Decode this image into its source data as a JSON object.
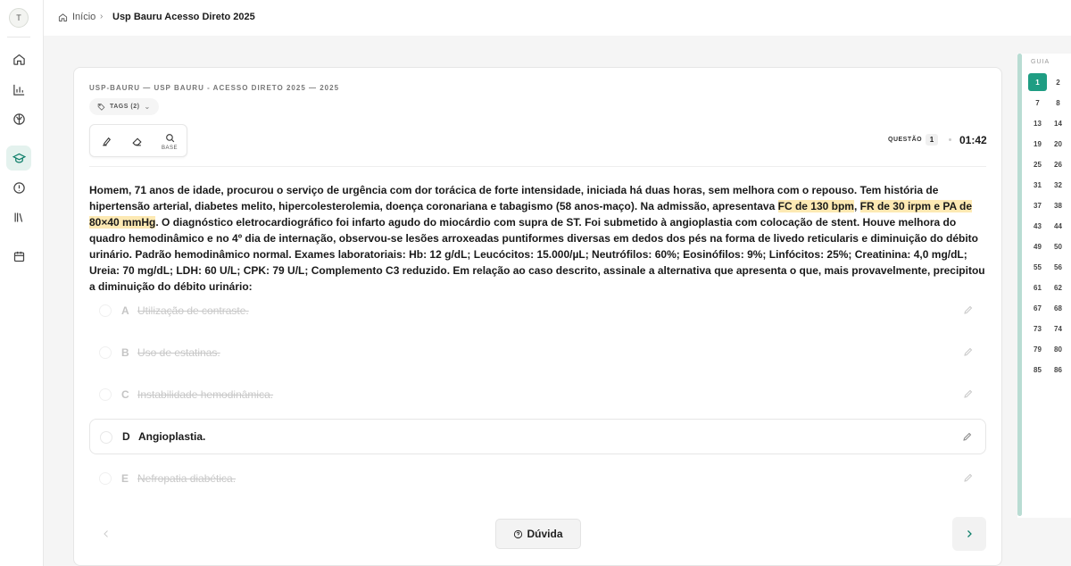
{
  "sidebar": {
    "avatar_initial": "T",
    "items": [
      {
        "icon": "home-icon",
        "active": false
      },
      {
        "icon": "bar-chart-icon",
        "active": false
      },
      {
        "icon": "brain-icon",
        "active": false
      },
      {
        "icon": "graduation-cap-icon",
        "active": true
      },
      {
        "icon": "alert-circle-icon",
        "active": false
      },
      {
        "icon": "library-icon",
        "active": false
      },
      {
        "icon": "calendar-icon",
        "active": false
      }
    ]
  },
  "breadcrumb": {
    "home": "Início",
    "separator": "›",
    "current": "Usp Bauru Acesso Direto 2025"
  },
  "card": {
    "header": "USP-BAURU — USP BAURU - ACESSO DIRETO 2025 — 2025",
    "tags_label": "TAGS (2)",
    "toolbar": {
      "base_label": "BASE"
    },
    "question_label": "QUESTÃO",
    "question_number": "1",
    "timer": "01:42"
  },
  "question": {
    "part1": "Homem, 71 anos de idade, procurou o serviço de urgência com dor torácica de forte intensidade, iniciada há duas horas, sem melhora com o repouso. Tem história de hipertensão arterial, diabetes melito, hipercolesterolemia, doença coronariana e tabagismo (58 anos-maço). Na admissão, apresentava ",
    "highlight1": "FC de 130 bpm",
    "comma": ", ",
    "highlight2": "FR de 30 irpm e PA de 80×40 mmHg",
    "part2": ". O diagnóstico eletrocardiográfico foi infarto agudo do miocárdio com supra de ST. Foi submetido à angioplastia com colocação de stent. Houve melhora do quadro hemodinâmico e no 4º dia de internação, observou-se lesões arroxeadas puntiformes diversas em dedos dos pés na forma de livedo reticularis e diminuição do débito urinário. Padrão hemodinâmico normal. Exames laboratoriais: Hb: 12 g/dL; Leucócitos: 15.000/µL; Neutrófilos: 60%; Eosinófilos: 9%; Linfócitos: 25%; Creatinina: 4,0 mg/dL; Ureia: 70 mg/dL; LDH: 60 U/L; CPK: 79 U/L; Complemento C3 reduzido. Em relação ao caso descrito, assinale a alternativa que apresenta o que, mais provavelmente, precipitou a diminuição do débito urinário:"
  },
  "options": [
    {
      "letter": "A",
      "text": "Utilização de contraste.",
      "struck": true
    },
    {
      "letter": "B",
      "text": "Uso de estatinas.",
      "struck": true
    },
    {
      "letter": "C",
      "text": "Instabilidade hemodinâmica.",
      "struck": true
    },
    {
      "letter": "D",
      "text": "Angioplastia.",
      "struck": false
    },
    {
      "letter": "E",
      "text": "Nefropatia diabética.",
      "struck": true
    }
  ],
  "footer": {
    "doubt_label": "Dúvida"
  },
  "guide": {
    "title": "GUIA",
    "current": "1",
    "numbers": [
      "1",
      "2",
      "7",
      "8",
      "13",
      "14",
      "19",
      "20",
      "25",
      "26",
      "31",
      "32",
      "37",
      "38",
      "43",
      "44",
      "49",
      "50",
      "55",
      "56",
      "61",
      "62",
      "67",
      "68",
      "73",
      "74",
      "79",
      "80",
      "85",
      "86"
    ]
  }
}
